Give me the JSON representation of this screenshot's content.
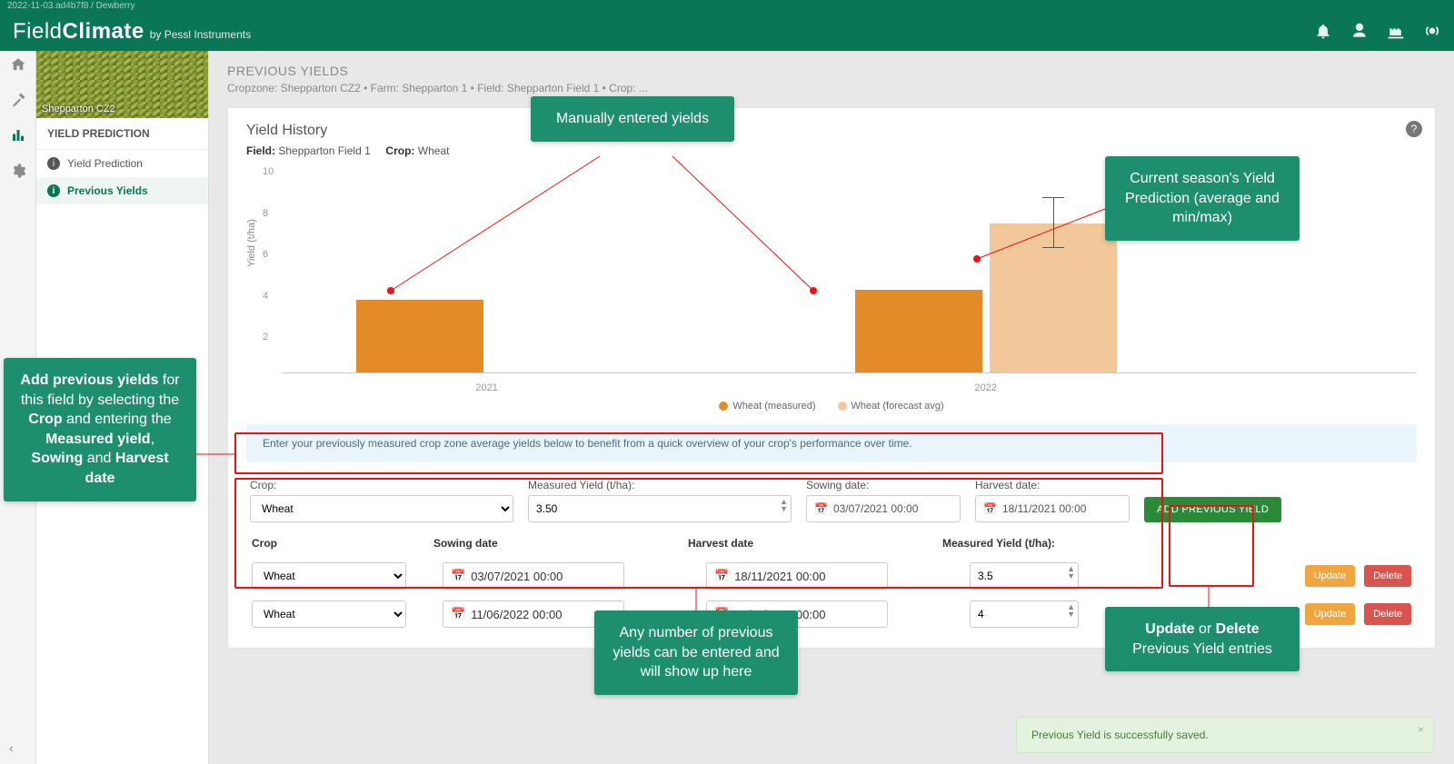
{
  "meta": {
    "ver": "2022-11-03.ad4b7f8 / Dewberry"
  },
  "brand": {
    "line1a": "Field",
    "line1b": "Climate",
    "sub": "by Pessl Instruments"
  },
  "side_img_label": "Shepparton CZ2",
  "side_head": "YIELD PREDICTION",
  "side_items": [
    {
      "label": "Yield Prediction",
      "active": false
    },
    {
      "label": "Previous Yields",
      "active": true
    }
  ],
  "crumbs": {
    "title": "PREVIOUS YIELDS",
    "path": "Cropzone: Shepparton CZ2 • Farm: Shepparton 1 • Field: Shepparton Field 1 • Crop: ..."
  },
  "yh": {
    "title": "Yield History",
    "field_lbl": "Field:",
    "field_val": "Shepparton Field 1",
    "crop_lbl": "Crop:",
    "crop_val": "Wheat"
  },
  "chart_data": {
    "type": "bar",
    "ylabel": "Yield (t/ha)",
    "ylim": [
      0,
      10
    ],
    "yticks": [
      2,
      4,
      6,
      8,
      10
    ],
    "categories": [
      "2021",
      "2022"
    ],
    "series": [
      {
        "name": "Wheat (measured)",
        "color": "#e38b27",
        "values": [
          3.5,
          4.0
        ]
      },
      {
        "name": "Wheat (forecast avg)",
        "color": "#f2c89a",
        "values": [
          null,
          7.2
        ],
        "error": [
          null,
          [
            6.0,
            8.4
          ]
        ]
      }
    ]
  },
  "info_text": "Enter your previously measured crop zone average yields below to benefit from a quick overview of your crop's performance over time.",
  "form": {
    "crop_lbl": "Crop:",
    "crop_val": "Wheat",
    "meas_lbl": "Measured Yield (t/ha):",
    "meas_val": "3.50",
    "sow_lbl": "Sowing date:",
    "sow_val": "03/07/2021 00:00",
    "harv_lbl": "Harvest date:",
    "harv_val": "18/11/2021 00:00",
    "add_btn": "ADD PREVIOUS YIELD"
  },
  "table": {
    "h_crop": "Crop",
    "h_sow": "Sowing date",
    "h_harv": "Harvest date",
    "h_meas": "Measured Yield (t/ha):",
    "rows": [
      {
        "crop": "Wheat",
        "sow": "03/07/2021 00:00",
        "harv": "18/11/2021 00:00",
        "meas": "3.5"
      },
      {
        "crop": "Wheat",
        "sow": "11/06/2022 00:00",
        "harv": "13/11/2022 00:00",
        "meas": "4"
      }
    ],
    "upd": "Update",
    "del": "Delete"
  },
  "toast": "Previous Yield is successfully saved.",
  "anno": {
    "a": "Manually entered yields",
    "b": "Current season's Yield Prediction (average and min/max)",
    "c_html": "<b>Add previous yields</b> for this field by selecting the <b>Crop</b> and entering the <b>Measured yield</b>, <b>Sowing</b> and <b>Harvest date</b>",
    "d": "Any number of previous yields can be entered and will show up here",
    "e_html": "<b>Update</b> or <b>Delete</b> Previous Yield entries"
  }
}
